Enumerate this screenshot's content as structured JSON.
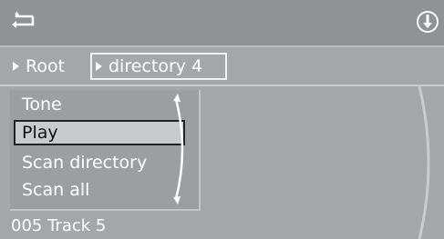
{
  "header": {
    "back_icon": "back-arrow-icon",
    "info_icon": "info-icon"
  },
  "breadcrumb": {
    "root": "Root",
    "current": "directory 4"
  },
  "menu": {
    "items": [
      {
        "label": "Tone",
        "selected": false
      },
      {
        "label": "Play",
        "selected": true
      },
      {
        "label": "Scan directory",
        "selected": false
      },
      {
        "label": "Scan all",
        "selected": false
      }
    ]
  },
  "status": {
    "track": "005 Track  5"
  }
}
